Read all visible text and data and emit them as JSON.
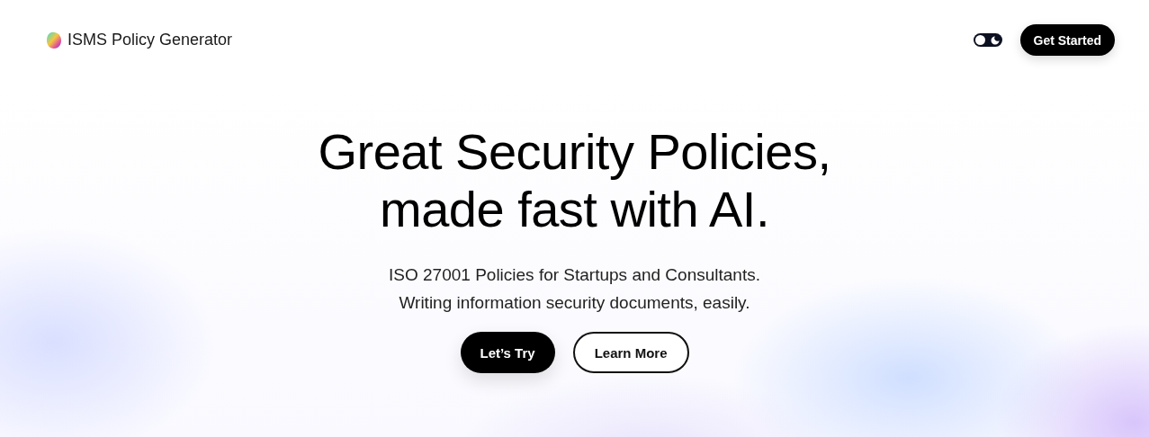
{
  "header": {
    "brand": "ISMS Policy Generator",
    "theme_toggle": {
      "on": false
    },
    "cta": "Get Started"
  },
  "hero": {
    "title_lines": [
      "Great Security Policies,",
      "made fast with AI."
    ],
    "subtitle_lines": [
      "ISO 27001 Policies for Startups and Consultants.",
      "Writing information security documents, easily."
    ],
    "buttons": [
      {
        "label": "Let’s Try",
        "kind": "primary"
      },
      {
        "label": "Learn More",
        "kind": "outline"
      }
    ]
  }
}
